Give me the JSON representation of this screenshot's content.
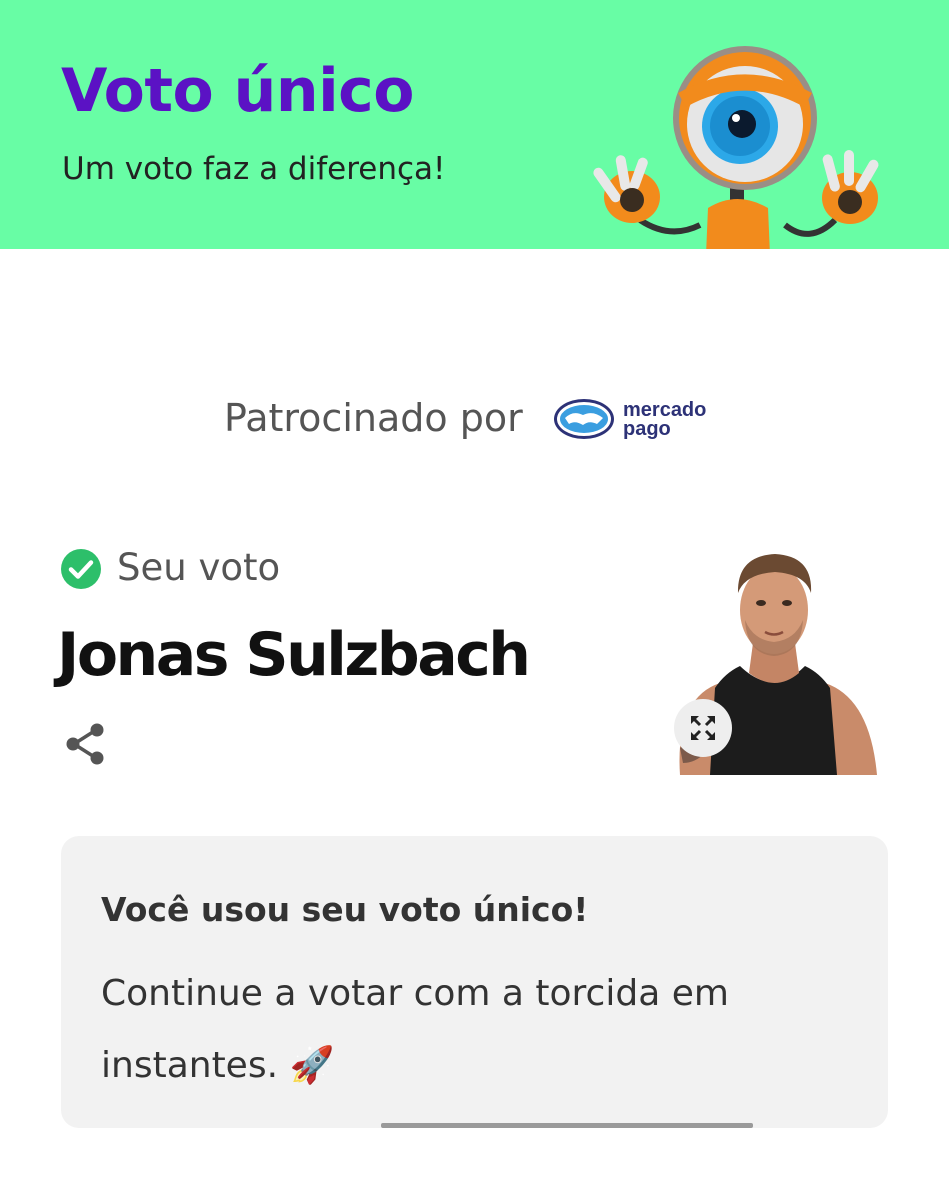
{
  "header": {
    "title": "Voto único",
    "subtitle": "Um voto faz a diferença!",
    "background_color": "#68fda5",
    "title_color": "#5b12c4",
    "mascot_icon": "big-brother-eye-mascot"
  },
  "sponsor": {
    "label": "Patrocinado por",
    "logo_line1": "mercado",
    "logo_line2": "pago",
    "logo_color": "#2d3277"
  },
  "vote": {
    "status_label": "Seu voto",
    "status_icon": "check-circle-icon",
    "check_color": "#2dbf6a",
    "candidate_name": "Jonas Sulzbach",
    "share_icon": "share-icon",
    "expand_icon": "expand-icon"
  },
  "info": {
    "title": "Você usou seu voto único!",
    "message": "Continue a votar com a torcida em instantes. 🚀"
  }
}
